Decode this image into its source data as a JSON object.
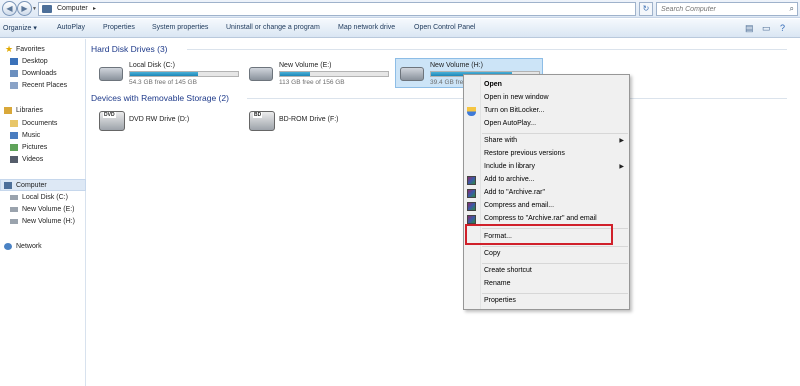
{
  "address_bar": {
    "path": "Computer",
    "search_placeholder": "Search Computer"
  },
  "toolbar": {
    "organize": "Organize",
    "autoplay": "AutoPlay",
    "properties": "Properties",
    "system_properties": "System properties",
    "uninstall": "Uninstall or change a program",
    "map_drive": "Map network drive",
    "control_panel": "Open Control Panel"
  },
  "sidebar": {
    "favorites": "Favorites",
    "desktop": "Desktop",
    "downloads": "Downloads",
    "recent_places": "Recent Places",
    "libraries": "Libraries",
    "documents": "Documents",
    "music": "Music",
    "pictures": "Pictures",
    "videos": "Videos",
    "computer": "Computer",
    "local_disk_c": "Local Disk (C:)",
    "new_volume_e": "New Volume (E:)",
    "new_volume_h": "New Volume (H:)",
    "network": "Network"
  },
  "content": {
    "hdd_header": "Hard Disk Drives (3)",
    "removable_header": "Devices with Removable Storage (2)",
    "drives": [
      {
        "name": "Local Disk (C:)",
        "free": "54.3 GB free of 145 GB",
        "used_fraction": 0.63
      },
      {
        "name": "New Volume (E:)",
        "free": "113 GB free of 156 GB",
        "used_fraction": 0.28
      },
      {
        "name": "New Volume (H:)",
        "free": "39.4 GB free",
        "used_fraction": 0.75
      }
    ],
    "optical": [
      {
        "name": "DVD RW Drive (D:)",
        "tag": "DVD"
      },
      {
        "name": "BD-ROM Drive (F:)",
        "tag": "BD"
      }
    ]
  },
  "context_menu": {
    "open": "Open",
    "open_new_window": "Open in new window",
    "bitlocker": "Turn on BitLocker...",
    "autoplay": "Open AutoPlay...",
    "share_with": "Share with",
    "restore": "Restore previous versions",
    "include_library": "Include in library",
    "add_archive": "Add to archive...",
    "add_archive_rar": "Add to \"Archive.rar\"",
    "compress_email": "Compress and email...",
    "compress_rar_email": "Compress to \"Archive.rar\" and email",
    "format": "Format...",
    "copy": "Copy",
    "create_shortcut": "Create shortcut",
    "rename": "Rename",
    "properties": "Properties"
  },
  "colors": {
    "accent": "#1e3a8a",
    "highlight": "#d0202a",
    "selection": "#cce4f7"
  }
}
